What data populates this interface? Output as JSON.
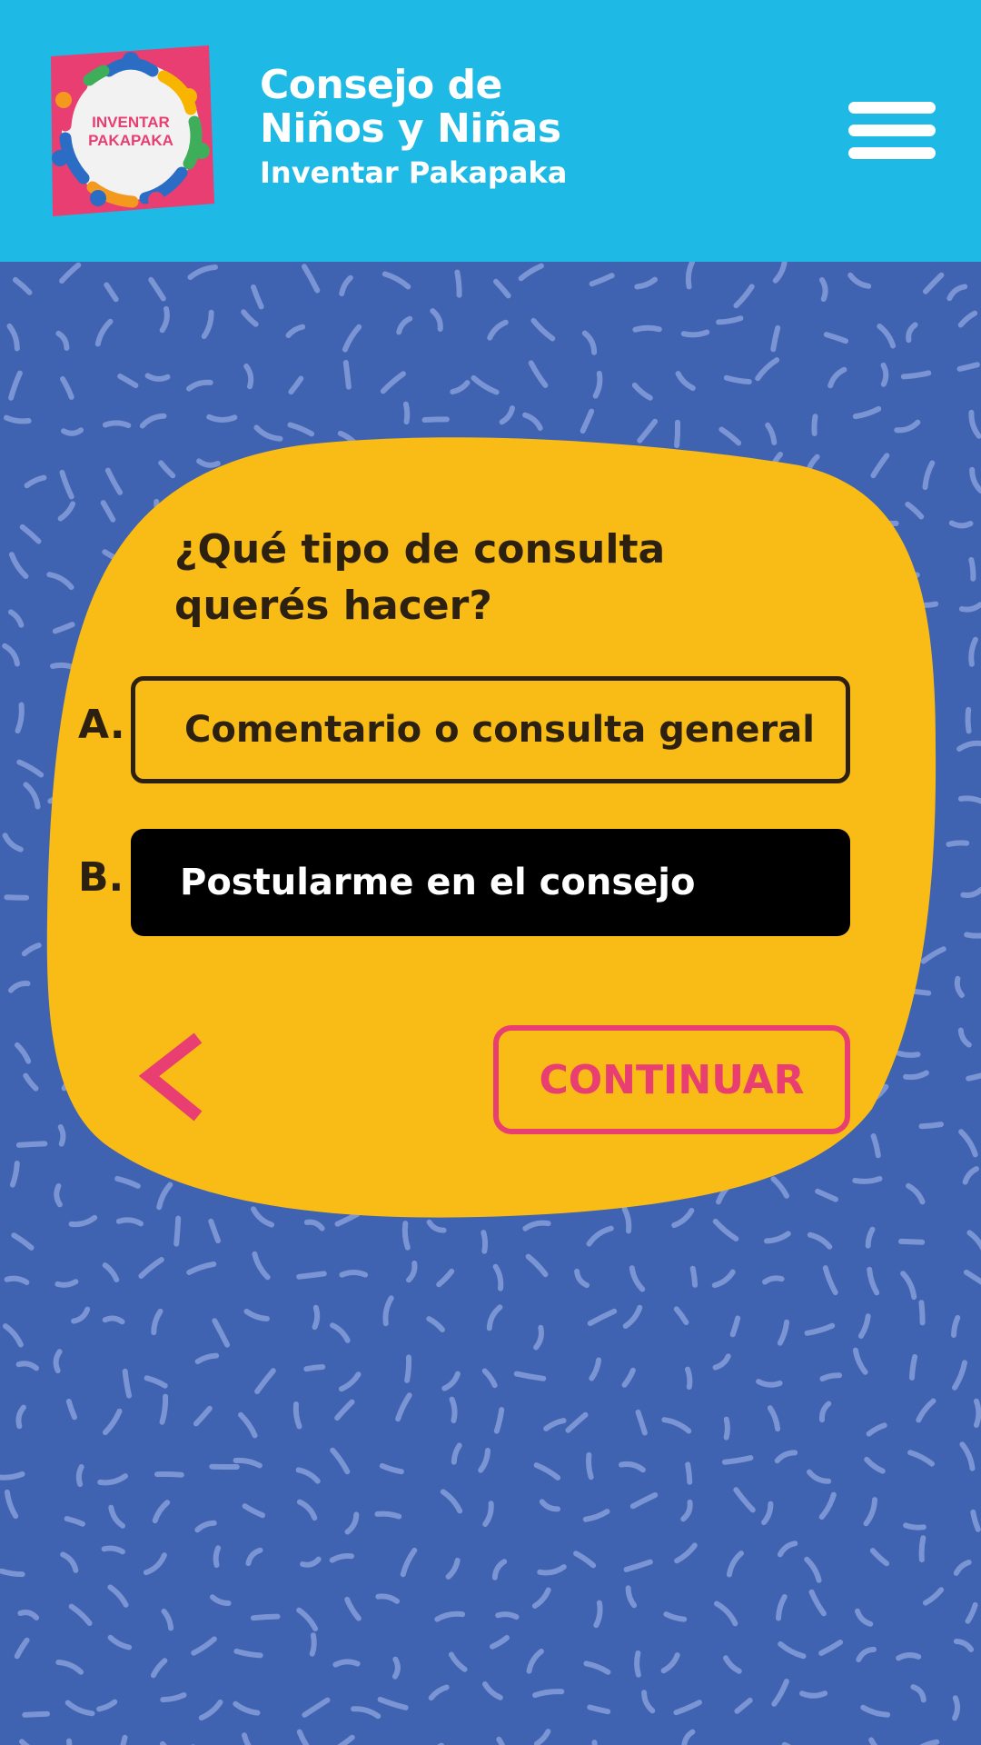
{
  "header": {
    "logo_text": [
      "INVENTAR",
      "PAKAPAKA"
    ],
    "title_line1": "Consejo de",
    "title_line2": "Niños y Niñas",
    "subtitle": "Inventar Pakapaka",
    "menu_icon": "hamburger-menu-icon"
  },
  "quiz": {
    "question": "¿Qué tipo de consulta querés hacer?",
    "options": [
      {
        "letter": "A.",
        "label": "Comentario o consulta general",
        "selected": false
      },
      {
        "letter": "B.",
        "label": "Postularme en el consejo",
        "selected": true
      }
    ],
    "back_icon": "chevron-left-icon",
    "continue_label": "CONTINUAR"
  },
  "colors": {
    "header_bg": "#1fb9e6",
    "page_bg": "#3f62b1",
    "pattern": "#7a94d4",
    "card": "#f9bb15",
    "accent": "#e83e72",
    "text_dark": "#2c2010",
    "selected_bg": "#000000"
  }
}
